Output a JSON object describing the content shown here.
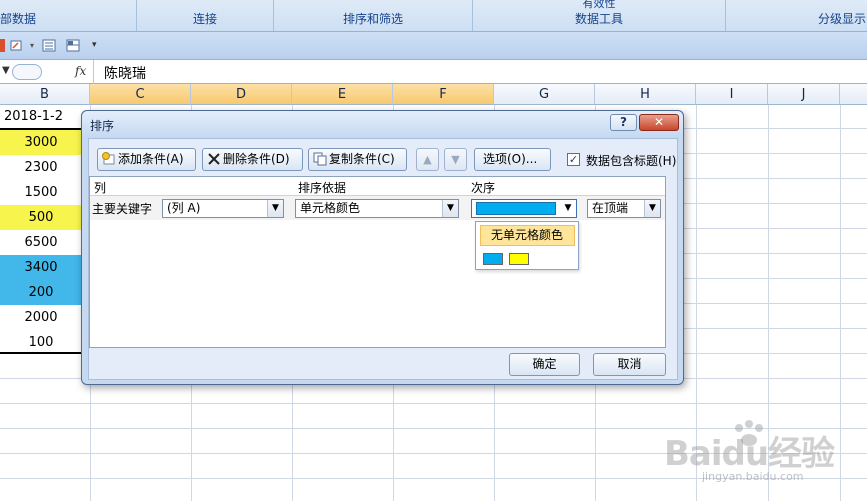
{
  "ribbon": {
    "groups": [
      {
        "label": "部数据"
      },
      {
        "label": "连接"
      },
      {
        "label": "排序和筛选"
      },
      {
        "label": "数据工具",
        "top": "有效性"
      },
      {
        "label": "分级显示"
      }
    ]
  },
  "formula_bar": {
    "fx_label": "fx",
    "value": "陈晓瑞"
  },
  "sheet": {
    "columns": [
      "B",
      "C",
      "D",
      "E",
      "F",
      "G",
      "H",
      "I",
      "J"
    ],
    "date_cell": "2018-1-2",
    "b_cells": [
      {
        "value": "3000",
        "fill": "#f7f44d"
      },
      {
        "value": "2300",
        "fill": "#ffffff"
      },
      {
        "value": "1500",
        "fill": "#ffffff"
      },
      {
        "value": "500",
        "fill": "#f7f44d"
      },
      {
        "value": "6500",
        "fill": "#ffffff"
      },
      {
        "value": "3400",
        "fill": "#41b7ea"
      },
      {
        "value": "200",
        "fill": "#41b7ea"
      },
      {
        "value": "2000",
        "fill": "#ffffff"
      },
      {
        "value": "100",
        "fill": "#ffffff"
      }
    ]
  },
  "dialog": {
    "title": "排序",
    "help_label": "?",
    "close_label": "✕",
    "add_level_label": "添加条件(A)",
    "delete_level_label": "删除条件(D)",
    "copy_level_label": "复制条件(C)",
    "move_up_label": "▲",
    "move_down_label": "▼",
    "options_label": "选项(O)...",
    "has_headers_label": "数据包含标题(H)",
    "has_headers_checked": true,
    "headers": {
      "column": "列",
      "sort_on": "排序依据",
      "order": "次序"
    },
    "row": {
      "label": "主要关键字",
      "column_value": "(列 A)",
      "sort_on_value": "单元格颜色",
      "order_color": "#00aeef",
      "position_value": "在顶端"
    },
    "color_dropdown": {
      "no_color_label": "无单元格颜色",
      "swatches": [
        "#00aeef",
        "#ffff00"
      ]
    },
    "ok_label": "确定",
    "cancel_label": "取消"
  },
  "watermark": {
    "text": "Baidu经验",
    "url": "jingyan.baidu.com"
  }
}
